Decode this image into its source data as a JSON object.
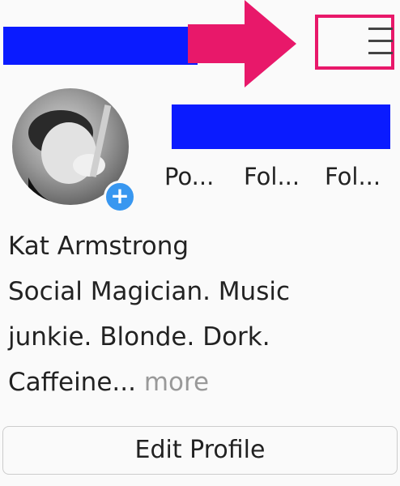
{
  "header": {
    "menu_icon": "hamburger-menu-icon",
    "annotation_color": "#e8186a",
    "redaction_color": "#0a1bff"
  },
  "profile": {
    "add_story_icon": "plus-icon",
    "stats": {
      "posts_label": "Po...",
      "followers_label": "Fol...",
      "following_label": "Fol..."
    },
    "bio": {
      "name": "Kat Armstrong",
      "line1": "Social Magician. Music",
      "line2": "junkie. Blonde. Dork.",
      "line3": "Caffeine...",
      "more": "more"
    },
    "edit_button_label": "Edit Profile"
  }
}
